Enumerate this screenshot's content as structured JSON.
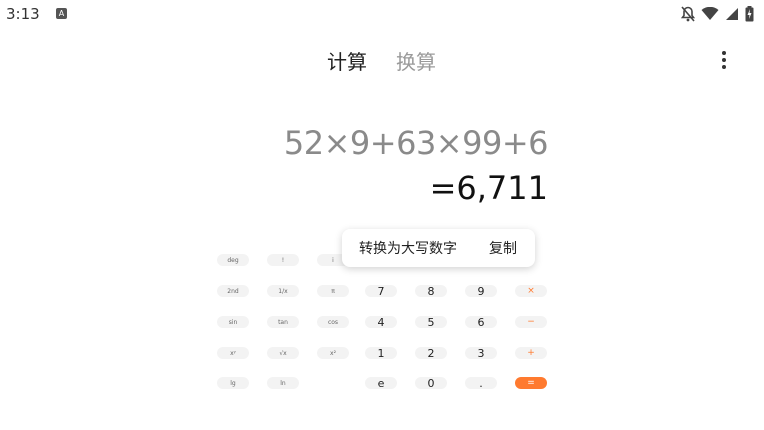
{
  "status_bar": {
    "time": "3:13",
    "badge": "A"
  },
  "header": {
    "tabs": [
      {
        "label": "计算"
      },
      {
        "label": "换算"
      }
    ]
  },
  "display": {
    "expression": "52×9+63×99+6",
    "result": "=6,711"
  },
  "popup": {
    "convert_label": "转换为大写数字",
    "copy_label": "复制"
  },
  "keypad": {
    "sci": [
      [
        "deg",
        "!",
        "i"
      ],
      [
        "2nd",
        "1/x",
        "π"
      ],
      [
        "sin",
        "tan",
        "cos"
      ],
      [
        "xʸ",
        "√x",
        "x²"
      ],
      [
        "lg",
        "ln",
        ""
      ]
    ],
    "main": [
      [
        "7",
        "8",
        "9",
        "×"
      ],
      [
        "4",
        "5",
        "6",
        "−"
      ],
      [
        "1",
        "2",
        "3",
        "+"
      ],
      [
        "e",
        "0",
        ".",
        "="
      ]
    ]
  },
  "colors": {
    "accent": "#ff7a2f"
  }
}
